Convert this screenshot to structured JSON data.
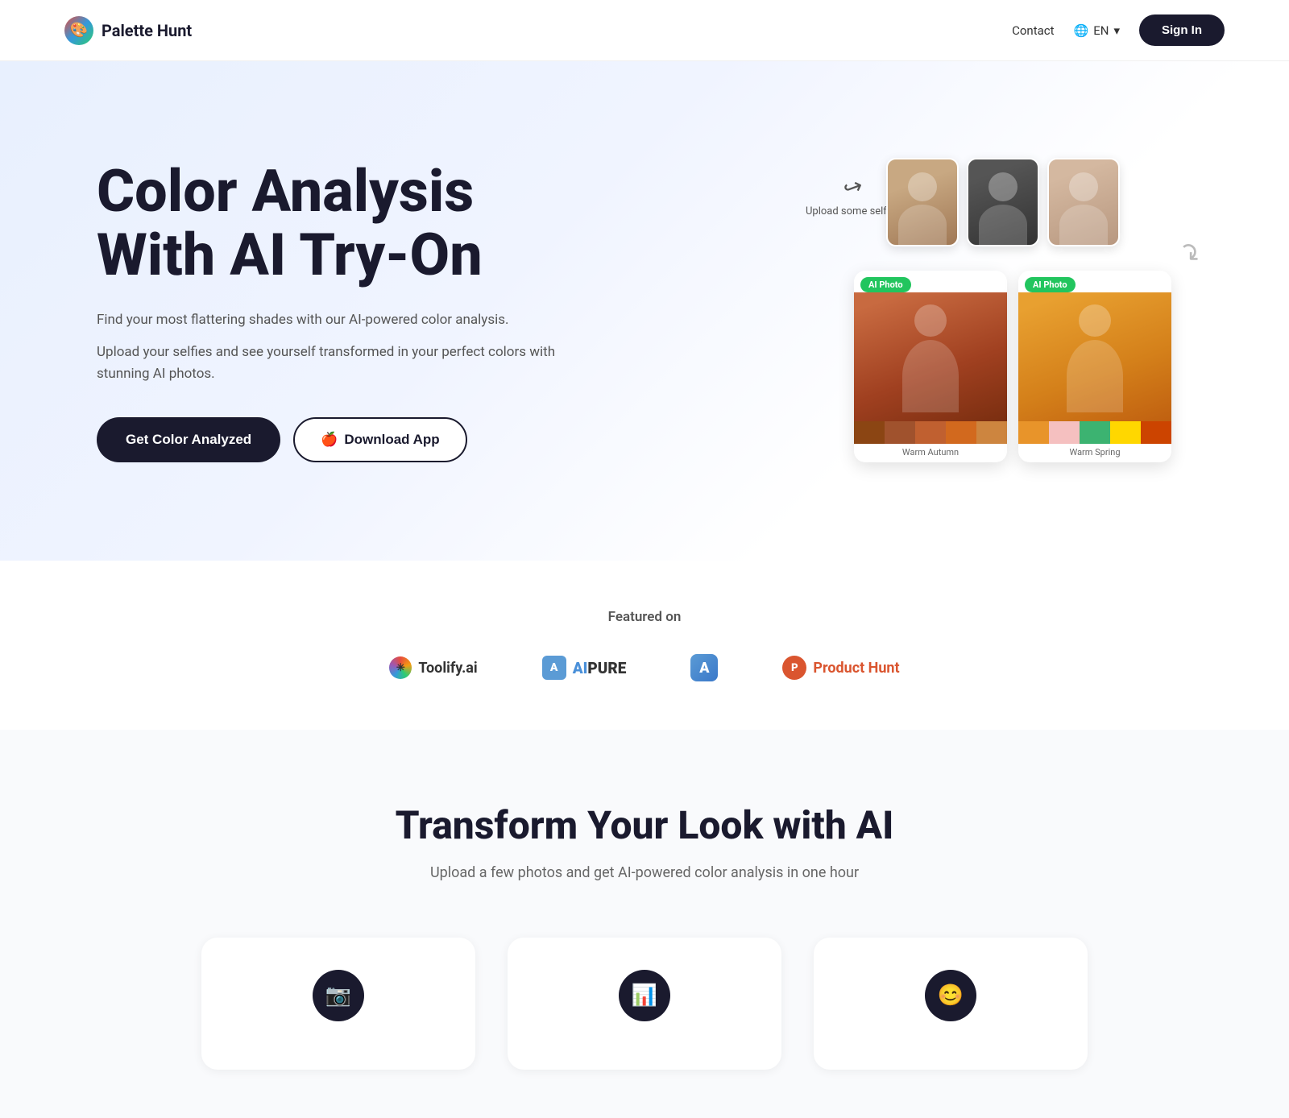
{
  "nav": {
    "logo_text": "Palette Hunt",
    "contact_label": "Contact",
    "lang_label": "EN",
    "signin_label": "Sign In"
  },
  "hero": {
    "title_line1": "Color Analysis",
    "title_line2": "With AI Try-On",
    "desc1": "Find your most flattering shades with our AI-powered color analysis.",
    "desc2": "Upload your selfies and see yourself transformed in your perfect colors with stunning AI photos.",
    "btn_primary": "Get Color Analyzed",
    "btn_secondary": "Download App",
    "upload_label": "Upload some selfies",
    "ai_badge": "AI Photo",
    "warm_autumn_label": "Warm Autumn",
    "warm_spring_label": "Warm Spring"
  },
  "featured": {
    "title": "Featured on",
    "logos": [
      {
        "name": "Toolify.ai",
        "id": "toolify"
      },
      {
        "name": "AIPURE",
        "id": "aipure"
      },
      {
        "name": "A",
        "id": "a-icon"
      },
      {
        "name": "Product Hunt",
        "id": "producthunt"
      }
    ]
  },
  "transform": {
    "title": "Transform Your Look with AI",
    "desc": "Upload a few photos and get AI-powered color analysis in one hour",
    "icons": [
      "📷",
      "📊",
      "😊"
    ]
  }
}
